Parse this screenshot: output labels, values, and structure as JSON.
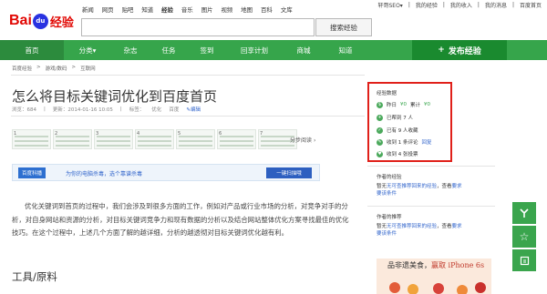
{
  "topnav": {
    "items": [
      "新闻",
      "网页",
      "贴吧",
      "知道",
      "经验",
      "音乐",
      "图片",
      "视频",
      "地图",
      "百科",
      "文库"
    ],
    "active_index": 4
  },
  "userlinks": [
    "轩哥SEO▾",
    "|",
    "我的经验",
    "|",
    "我的收入",
    "|",
    "我的消息",
    "|",
    "百度首页"
  ],
  "logo": {
    "bai": "Bai",
    "paw": "du",
    "jingyan": "经验"
  },
  "search": {
    "placeholder": "",
    "button": "搜索经验"
  },
  "greennav": {
    "items": [
      "首页",
      "分类▾",
      "杂志",
      "任务",
      "签到",
      "回享计划",
      "商城",
      "知道"
    ],
    "active_index": 0
  },
  "publish": {
    "label": "发布经验",
    "icon": "+"
  },
  "breadcrumb": [
    "百度经验",
    ">",
    "游戏/数码",
    ">",
    "互联网"
  ],
  "article": {
    "title": "怎么将目标关键词优化到百度首页",
    "meta": [
      "浏览：684",
      "|",
      "更新：2014-01-16 10:05",
      "|",
      "标签：",
      "优化",
      "百度"
    ],
    "edit_label": "编辑",
    "thumbs": [
      "1",
      "2",
      "3",
      "4",
      "5",
      "6",
      "7"
    ],
    "fenbu_label": "分步阅读",
    "fenbu_icon": "›",
    "banner": {
      "tag": "百度科播",
      "text": "为你的电脑杀毒，选个靠谱杀毒",
      "button": "一键扫描哦"
    },
    "body": "优化关键词到首页的过程中，我们会涉及到很多方面的工作，例如对产品或行业市场的分析，对竞争对手的分析，对自身网站和资源的分析，对目标关键词竞争力和现有数据的分析以及结合网站整体优化方案寻找最佳的优化技巧。在这个过程中，上述几个方面了解的越详细，分析的越透彻对目标关键词优化越有利。",
    "section_title": "工具/原料"
  },
  "sidebar": {
    "stats_title": "经验数据",
    "stats": [
      {
        "icon": "$",
        "parts": [
          "昨日",
          "¥0",
          "累计",
          "¥0"
        ]
      },
      {
        "icon": "+",
        "parts": [
          "已帮到 7 人"
        ]
      },
      {
        "icon": "✓",
        "parts": [
          "已有 9 人收藏"
        ]
      },
      {
        "icon": "✎",
        "parts": [
          "收到 1 条评论",
          "回复"
        ]
      },
      {
        "icon": "♥",
        "parts": [
          "收到 4 张投票"
        ]
      }
    ],
    "recommend1": {
      "title": "作者的经验",
      "text": "暂无",
      "link": "无可查推荐回来的经验",
      "text2": "，查看",
      "link2": "要求",
      "more": "要该条件"
    },
    "recommend2": {
      "title": "作者的推荐",
      "text": "暂无",
      "link": "无可查推荐回来的经验",
      "text2": "，查看",
      "link2": "要求",
      "more": "要该条件"
    },
    "ad": {
      "text_a": "品非遗美食，",
      "text_b": "赢取 iPhone 6s"
    }
  },
  "tools": [
    "share-icon",
    "star-icon",
    "edit-icon"
  ],
  "colors": {
    "green": "#36a54b",
    "red_box": "#e0201a",
    "link": "#3366cc"
  }
}
